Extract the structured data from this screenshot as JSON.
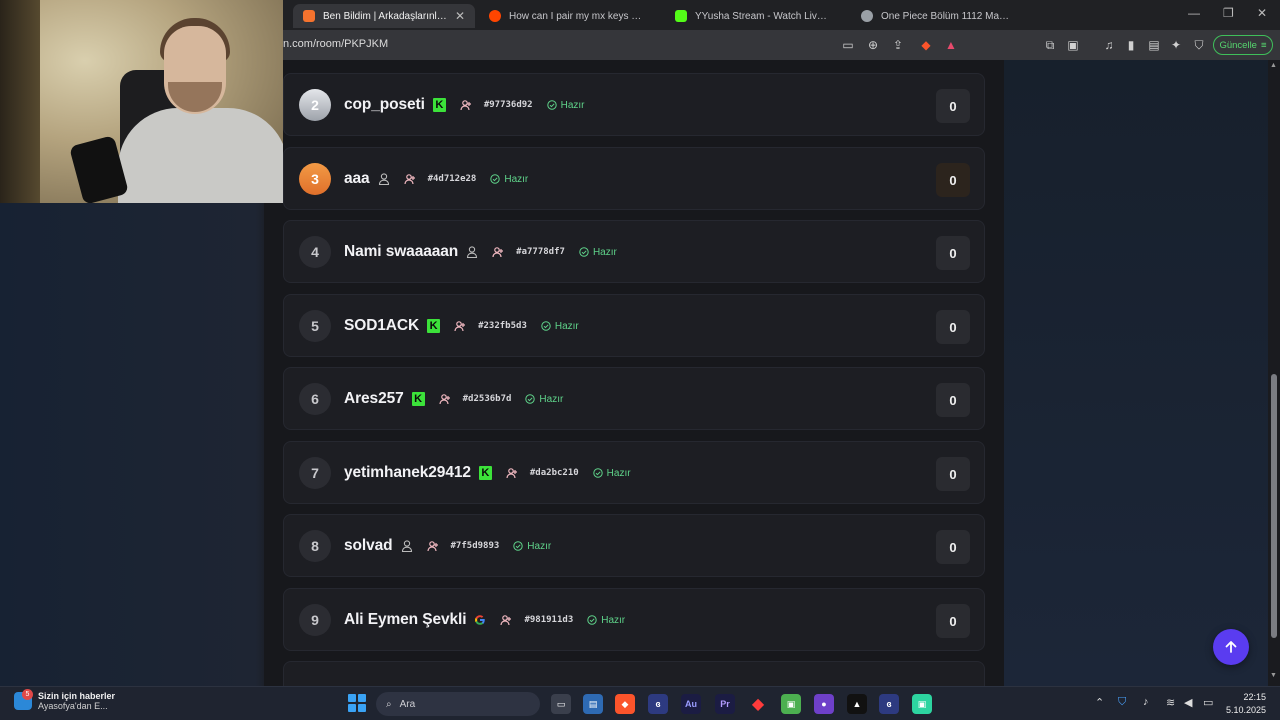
{
  "browser": {
    "tabs": [
      {
        "title": "Ben Bildim | Arkadaşlarınla Onlin",
        "active": true,
        "favicon_color": "#f5732e"
      },
      {
        "title": "How can I pair my mx keys mini? | re",
        "active": false,
        "favicon_color": "#ff4500"
      },
      {
        "title": "YYusha Stream - Watch Live on K",
        "active": false,
        "favicon_color": "#53fc18"
      },
      {
        "title": "One Piece Bölüm 1112 Manga Oku",
        "active": false,
        "favicon_color": "#9aa0a6"
      }
    ],
    "url": "n.com/room/PKPJKM",
    "update_label": "Güncelle",
    "brave_badge": "2"
  },
  "players": [
    {
      "rank": "2",
      "name": "cop_poseti",
      "platform": "kick",
      "code": "#97736d92",
      "status": "Hazır",
      "score": "0"
    },
    {
      "rank": "3",
      "name": "aaa",
      "platform": "user",
      "code": "#4d712e28",
      "status": "Hazır",
      "score": "0"
    },
    {
      "rank": "4",
      "name": "Nami swaaaaan",
      "platform": "user",
      "code": "#a7778df7",
      "status": "Hazır",
      "score": "0"
    },
    {
      "rank": "5",
      "name": "SOD1ACK",
      "platform": "kick",
      "code": "#232fb5d3",
      "status": "Hazır",
      "score": "0"
    },
    {
      "rank": "6",
      "name": "Ares257",
      "platform": "kick",
      "code": "#d2536b7d",
      "status": "Hazır",
      "score": "0"
    },
    {
      "rank": "7",
      "name": "yetimhanek29412",
      "platform": "kick",
      "code": "#da2bc210",
      "status": "Hazır",
      "score": "0"
    },
    {
      "rank": "8",
      "name": "solvad",
      "platform": "user",
      "code": "#7f5d9893",
      "status": "Hazır",
      "score": "0"
    },
    {
      "rank": "9",
      "name": "Ali Eymen Şevkli",
      "platform": "google",
      "code": "#981911d3",
      "status": "Hazır",
      "score": "0"
    }
  ],
  "taskbar": {
    "news_title": "Sizin için haberler",
    "news_sub": "Ayasofya'dan E...",
    "news_badge": "5",
    "search_placeholder": "Ara",
    "time": "22:15",
    "date": "5.10.2025",
    "apps": [
      "Au",
      "Pr"
    ]
  },
  "colors": {
    "accent": "#5a3cf0",
    "ready": "#5fd38a",
    "kick": "#3ce23a",
    "update": "#56d66f"
  }
}
